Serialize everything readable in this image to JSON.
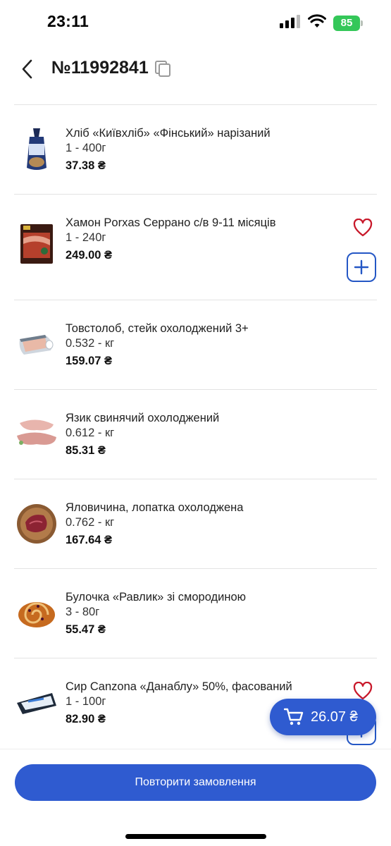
{
  "status_bar": {
    "time": "23:11",
    "battery": "85"
  },
  "header": {
    "order_number": "№11992841"
  },
  "items": [
    {
      "name": "Хліб «Київхліб» «Фінський» нарізаний",
      "qty": "1 - 400г",
      "price": "37.38 ₴"
    },
    {
      "name": "Хамон Porxas Серрано с/в 9-11 місяців",
      "qty": "1 - 240г",
      "price": "249.00 ₴"
    },
    {
      "name": "Товстолоб, стейк охолоджений 3+",
      "qty": "0.532 - кг",
      "price": "159.07 ₴"
    },
    {
      "name": "Язик свинячий охолоджений",
      "qty": "0.612 - кг",
      "price": "85.31 ₴"
    },
    {
      "name": "Яловичина, лопатка охолоджена",
      "qty": "0.762 - кг",
      "price": "167.64 ₴"
    },
    {
      "name": "Булочка «Равлик» зі смородиною",
      "qty": "3 - 80г",
      "price": "55.47 ₴"
    },
    {
      "name": "Сир Canzona «Данаблу» 50%, фасований",
      "qty": "1 - 100г",
      "price": "82.90 ₴"
    }
  ],
  "cart": {
    "total": "26.07 ₴"
  },
  "actions": {
    "repeat_order_label": "Повторити замовлення"
  },
  "colors": {
    "accent": "#2f5bd0",
    "favorite": "#c8182a",
    "battery": "#34c759"
  }
}
